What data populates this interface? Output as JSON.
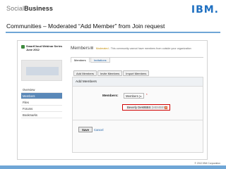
{
  "header": {
    "brand_light": "Social",
    "brand_bold": "Business",
    "ibm_logo": "IBM."
  },
  "slide": {
    "title": "Communities – Moderated “Add Member” from Join request"
  },
  "community": {
    "name": "SmartCloud Webinar Series June 2012"
  },
  "nav": {
    "items": [
      "Overview",
      "Members",
      "Files",
      "Forums",
      "Bookmarks"
    ],
    "active_index": 1
  },
  "page": {
    "heading": "Members",
    "note_label": "Moderated",
    "note_text": "- This community cannot have members from outside your organization",
    "tabs": [
      "Members",
      "Invitations"
    ]
  },
  "buttons": [
    "Add Members",
    "Invite Members",
    "Import Members"
  ],
  "add_members": {
    "title": "Add Members",
    "members_label": "Members:",
    "role_selected": "Members",
    "role_chevron": "▾",
    "required_mark": "*",
    "chip_name": "Beverly DeMIBBS",
    "chip_suffix": "(MEMBER)",
    "chip_remove": "x",
    "save_label": "Save",
    "cancel_label": "Cancel"
  },
  "footer": {
    "copyright": "© 2012 IBM Corporation"
  },
  "colors": {
    "accent_rule": "#6fa6d6",
    "ibm_blue": "#1f70c1",
    "highlight_box": "#d00000",
    "active_nav": "#5a88b8"
  }
}
